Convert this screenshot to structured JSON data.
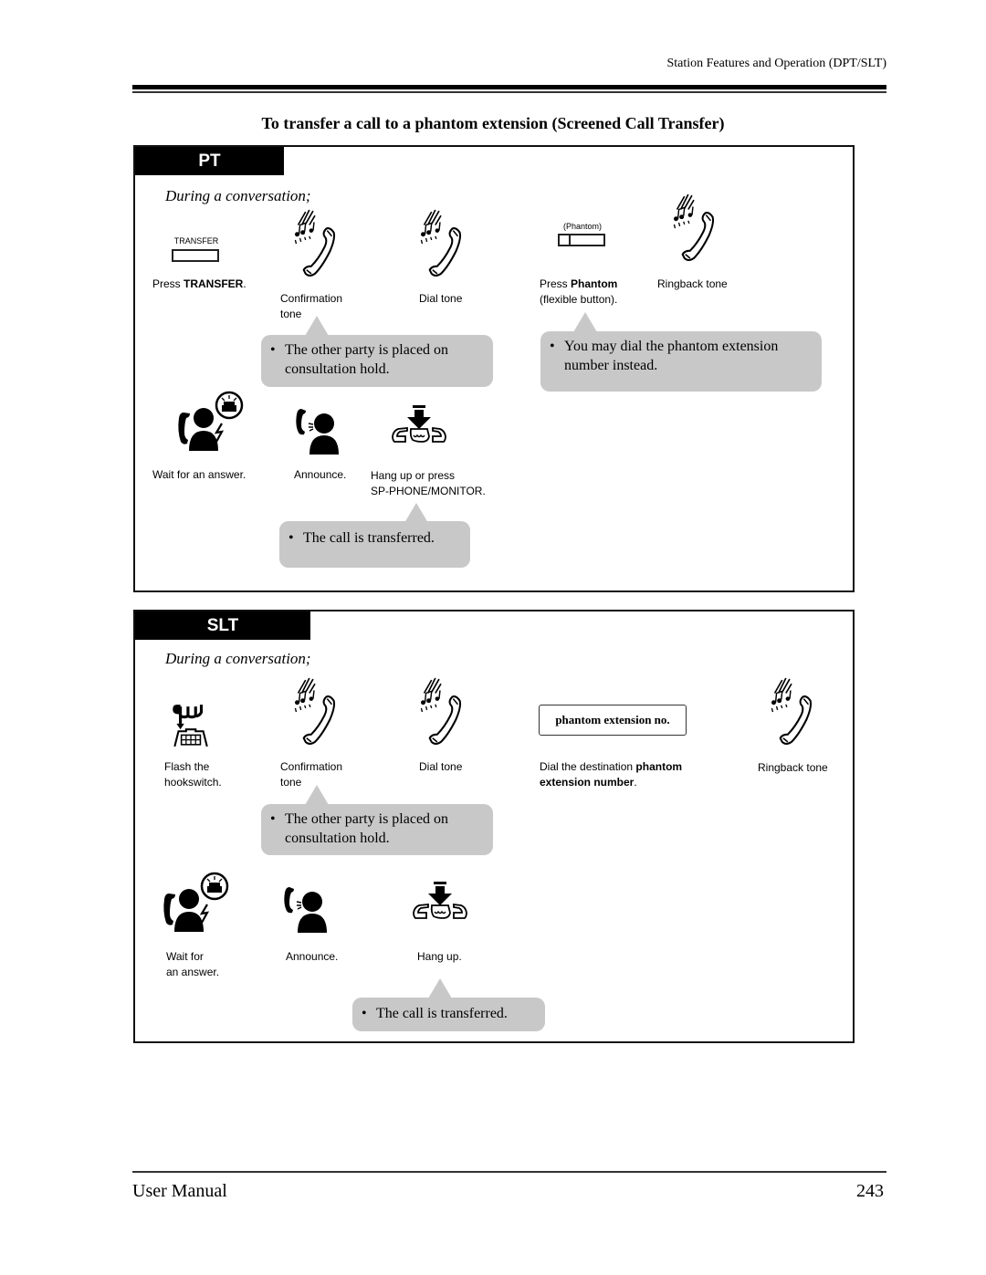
{
  "header": {
    "running_head": "Station Features and Operation (DPT/SLT)"
  },
  "section": {
    "title": "To transfer a call to a phantom extension (Screened Call Transfer)"
  },
  "pt": {
    "tab_label": "PT",
    "intro": "During a conversation;",
    "transfer_key_label": "TRANSFER",
    "phantom_key_label": "(Phantom)",
    "steps": {
      "press_transfer_prefix": "Press ",
      "press_transfer_bold": "TRANSFER",
      "press_transfer_suffix": ".",
      "confirmation_tone_line1": "Confirmation",
      "confirmation_tone_line2": "tone",
      "dial_tone": "Dial tone",
      "press_phantom_prefix": "Press ",
      "press_phantom_bold": "Phantom",
      "press_phantom_line2": "(flexible button).",
      "ringback_tone": "Ringback tone",
      "wait_for_answer": "Wait for an answer.",
      "announce": "Announce.",
      "hang_up_line1": "Hang up or press",
      "hang_up_line2": "SP-PHONE/MONITOR."
    },
    "notes": {
      "hold_line1": "The other party is placed on",
      "hold_line2": "consultation hold.",
      "phantom_line1": "You may dial the phantom extension",
      "phantom_line2": "number instead.",
      "transferred": "The call is transferred."
    }
  },
  "slt": {
    "tab_label": "SLT",
    "intro": "During a conversation;",
    "dial_box_label": "phantom extension no.",
    "steps": {
      "flash_line1": "Flash the",
      "flash_line2": "hookswitch.",
      "confirmation_tone_line1": "Confirmation",
      "confirmation_tone_line2": "tone",
      "dial_tone": "Dial tone",
      "dial_dest_prefix": "Dial the destination ",
      "dial_dest_bold1": "phantom",
      "dial_dest_bold2": "extension number",
      "dial_dest_suffix": ".",
      "ringback_tone": "Ringback tone",
      "wait_line1": "Wait for",
      "wait_line2": "an answer.",
      "announce": "Announce.",
      "hang_up": "Hang up."
    },
    "notes": {
      "hold_line1": "The other party is placed on",
      "hold_line2": "consultation hold.",
      "transferred": "The call is transferred."
    }
  },
  "notes_bullet": "•",
  "footer": {
    "left": "User Manual",
    "page_number": "243"
  },
  "icons": {
    "handset_tone": "handset-with-music-notes-icon",
    "wait_answer": "person-on-phone-with-ringing-phone-icon",
    "announce": "person-speaking-into-phone-icon",
    "hang_up": "hands-hang-up-arrow-icon",
    "hookswitch": "hookswitch-flash-icon"
  },
  "colors": {
    "note_bubble": "#c8c8c8",
    "tab_background": "#000000",
    "tab_text": "#ffffff"
  }
}
